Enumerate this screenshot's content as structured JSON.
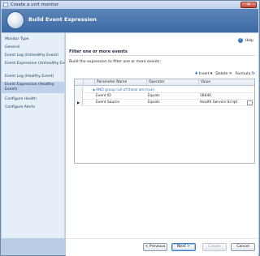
{
  "window": {
    "title": "Create a unit monitor"
  },
  "banner": {
    "title": "Build Event Expression"
  },
  "nav": {
    "items": [
      {
        "label": "Monitor Type",
        "selected": false
      },
      {
        "label": "General",
        "selected": false
      },
      {
        "label": "Event Log (Unhealthy Event)",
        "selected": false
      },
      {
        "label": "Event Expression (Unhealthy Event)",
        "selected": false
      },
      {
        "label": "Event Log (Healthy Event)",
        "selected": false
      },
      {
        "label": "Event Expression (Healthy Event)",
        "selected": true
      },
      {
        "label": "Configure Health",
        "selected": false
      },
      {
        "label": "Configure Alerts",
        "selected": false
      }
    ]
  },
  "content": {
    "help_label": "Help",
    "heading": "Filter one or more events",
    "instructions": "Build the expression to filter one or more events:",
    "toolbar": {
      "insert_label": "Insert",
      "delete_label": "Delete",
      "formula_label": "Formula"
    },
    "grid": {
      "columns": [
        "Parameter Name",
        "Operator",
        "Value"
      ],
      "group_row": "AND group (all of these are true)",
      "rows": [
        {
          "parameter": "Event ID",
          "operator": "Equals",
          "value": "18040"
        },
        {
          "parameter": "Event Source",
          "operator": "Equals",
          "value": "Health Service Script"
        }
      ]
    }
  },
  "footer": {
    "previous_label": "< Previous",
    "next_label": "Next >",
    "create_label": "Create",
    "cancel_label": "Cancel"
  },
  "colors": {
    "banner": "#4a75ad",
    "nav_selected": "#bfd2ea",
    "window_frame": "#b9cde5"
  }
}
